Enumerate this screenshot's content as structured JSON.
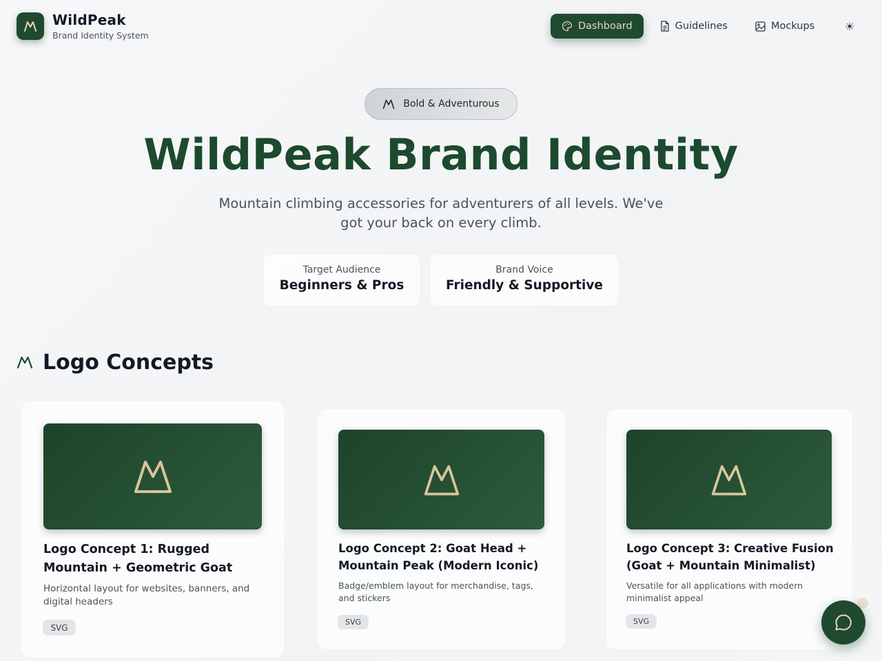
{
  "header": {
    "brand_name": "WildPeak",
    "brand_tagline": "Brand Identity System",
    "nav": [
      {
        "label": "Dashboard",
        "icon": "palette-icon",
        "active": true
      },
      {
        "label": "Guidelines",
        "icon": "document-icon",
        "active": false
      },
      {
        "label": "Mockups",
        "icon": "image-icon",
        "active": false
      }
    ],
    "theme_toggle_icon": "☀"
  },
  "hero": {
    "pill_label": "Bold & Adventurous",
    "title": "WildPeak Brand Identity",
    "subtitle": "Mountain climbing accessories for adventurers of all levels. We've got your back on every climb.",
    "stats": [
      {
        "label": "Target Audience",
        "value": "Beginners & Pros"
      },
      {
        "label": "Brand Voice",
        "value": "Friendly & Supportive"
      }
    ]
  },
  "logo_concepts": {
    "section_title": "Logo Concepts",
    "cards": [
      {
        "title": "Logo Concept 1: Rugged Mountain + Geometric Goat",
        "description": "Horizontal layout for websites, banners, and digital headers",
        "format": "SVG"
      },
      {
        "title": "Logo Concept 2: Goat Head + Mountain Peak (Modern Iconic)",
        "description": "Badge/emblem layout for merchandise, tags, and stickers",
        "format": "SVG"
      },
      {
        "title": "Logo Concept 3: Creative Fusion (Goat + Mountain Minimalist)",
        "description": "Versatile for all applications with modern minimalist appeal",
        "format": "SVG"
      }
    ]
  },
  "colors": {
    "forest_green": "#1f4a30",
    "sand": "#d9c59a",
    "title_green": "#1d4a2e"
  },
  "chat": {
    "icon": "chat-bubble-icon"
  }
}
